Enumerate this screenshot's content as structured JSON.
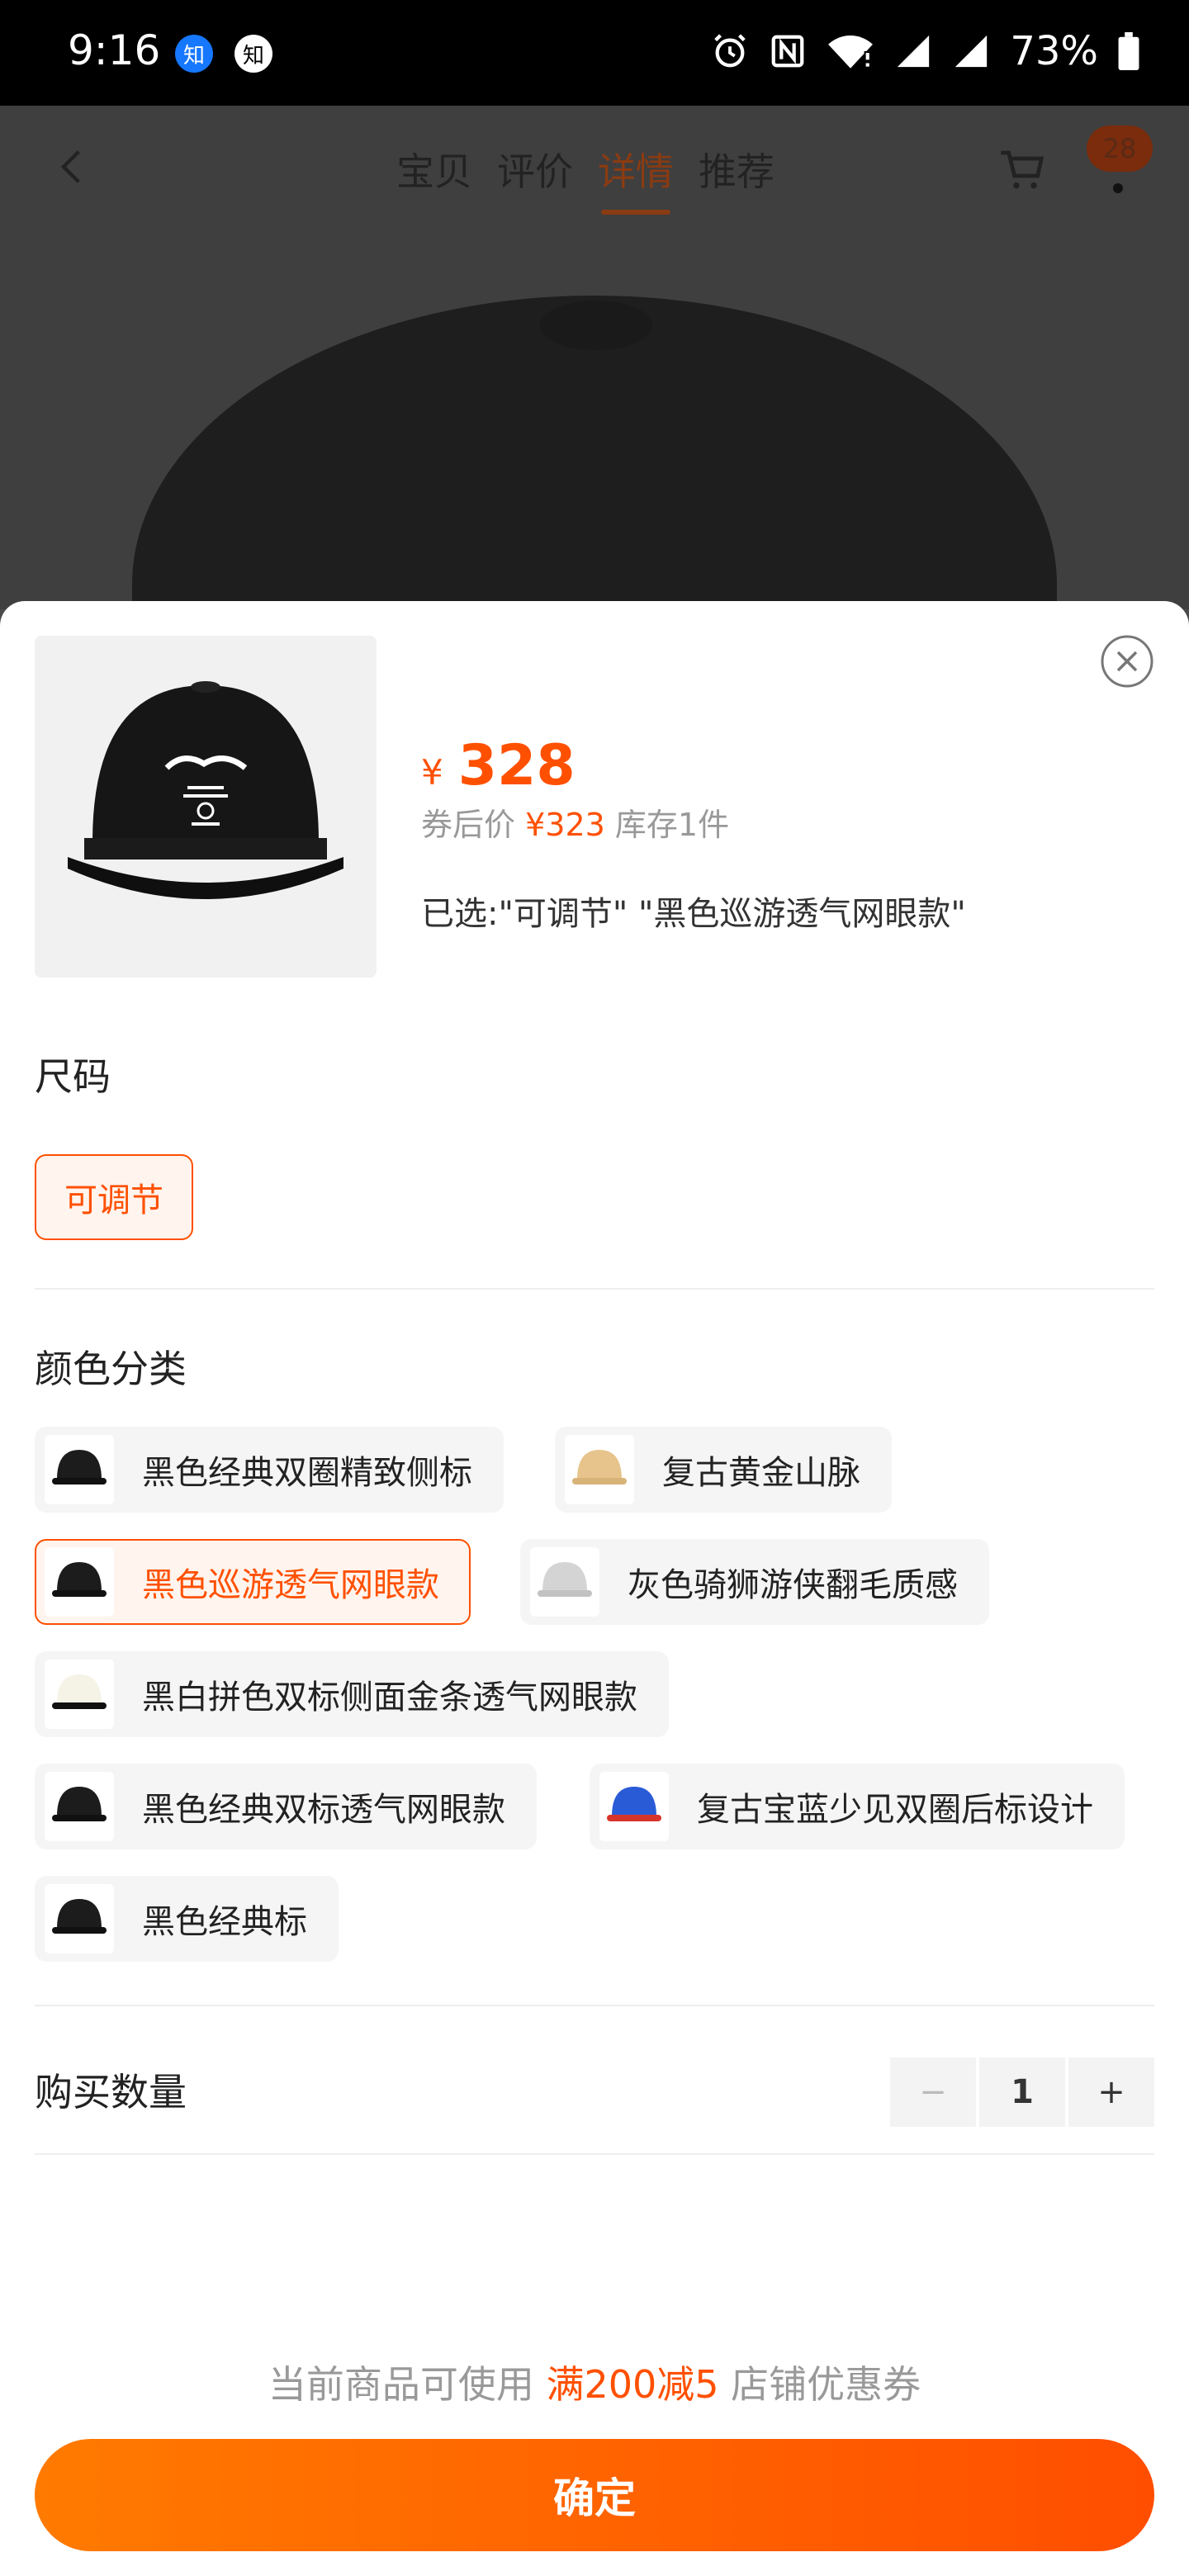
{
  "status_bar": {
    "time": "9:16",
    "app_icon_1": "知",
    "app_icon_2": "知",
    "battery": "73%"
  },
  "nav": {
    "tabs": [
      {
        "label": "宝贝",
        "active": false
      },
      {
        "label": "评价",
        "active": false
      },
      {
        "label": "详情",
        "active": true
      },
      {
        "label": "推荐",
        "active": false
      }
    ],
    "cart_badge": "28"
  },
  "product": {
    "currency": "¥",
    "price": "328",
    "coupon_prefix": "券后价",
    "coupon_price": "¥323",
    "stock": "库存1件",
    "selected": "已选:\"可调节\" \"黑色巡游透气网眼款\""
  },
  "size": {
    "title": "尺码",
    "options": [
      "可调节"
    ],
    "selected": "可调节"
  },
  "color": {
    "title": "颜色分类",
    "options": [
      {
        "label": "黑色经典双圈精致侧标",
        "swatch": "#1c1c1c",
        "selected": false
      },
      {
        "label": "复古黄金山脉",
        "swatch": "#e7c48c",
        "selected": false
      },
      {
        "label": "黑色巡游透气网眼款",
        "swatch": "#1c1c1c",
        "selected": true
      },
      {
        "label": "灰色骑狮游侠翻毛质感",
        "swatch": "#d4d4d4",
        "selected": false
      },
      {
        "label": "黑白拼色双标侧面金条透气网眼款",
        "swatch": "#f5f3e6",
        "selected": false
      },
      {
        "label": "黑色经典双标透气网眼款",
        "swatch": "#1c1c1c",
        "selected": false
      },
      {
        "label": "复古宝蓝少见双圈后标设计",
        "swatch": "#2a5bd7",
        "selected": false
      },
      {
        "label": "黑色经典标",
        "swatch": "#1c1c1c",
        "selected": false
      }
    ]
  },
  "quantity": {
    "title": "购买数量",
    "minus": "−",
    "value": "1",
    "plus": "+"
  },
  "shop_coupon": {
    "prefix": "当前商品可使用",
    "highlight": "满200减5",
    "suffix": "店铺优惠券"
  },
  "confirm_label": "确定",
  "colors": {
    "accent": "#ff5000",
    "button_gradient_start": "#ff7a00",
    "button_gradient_end": "#ff4e00"
  }
}
